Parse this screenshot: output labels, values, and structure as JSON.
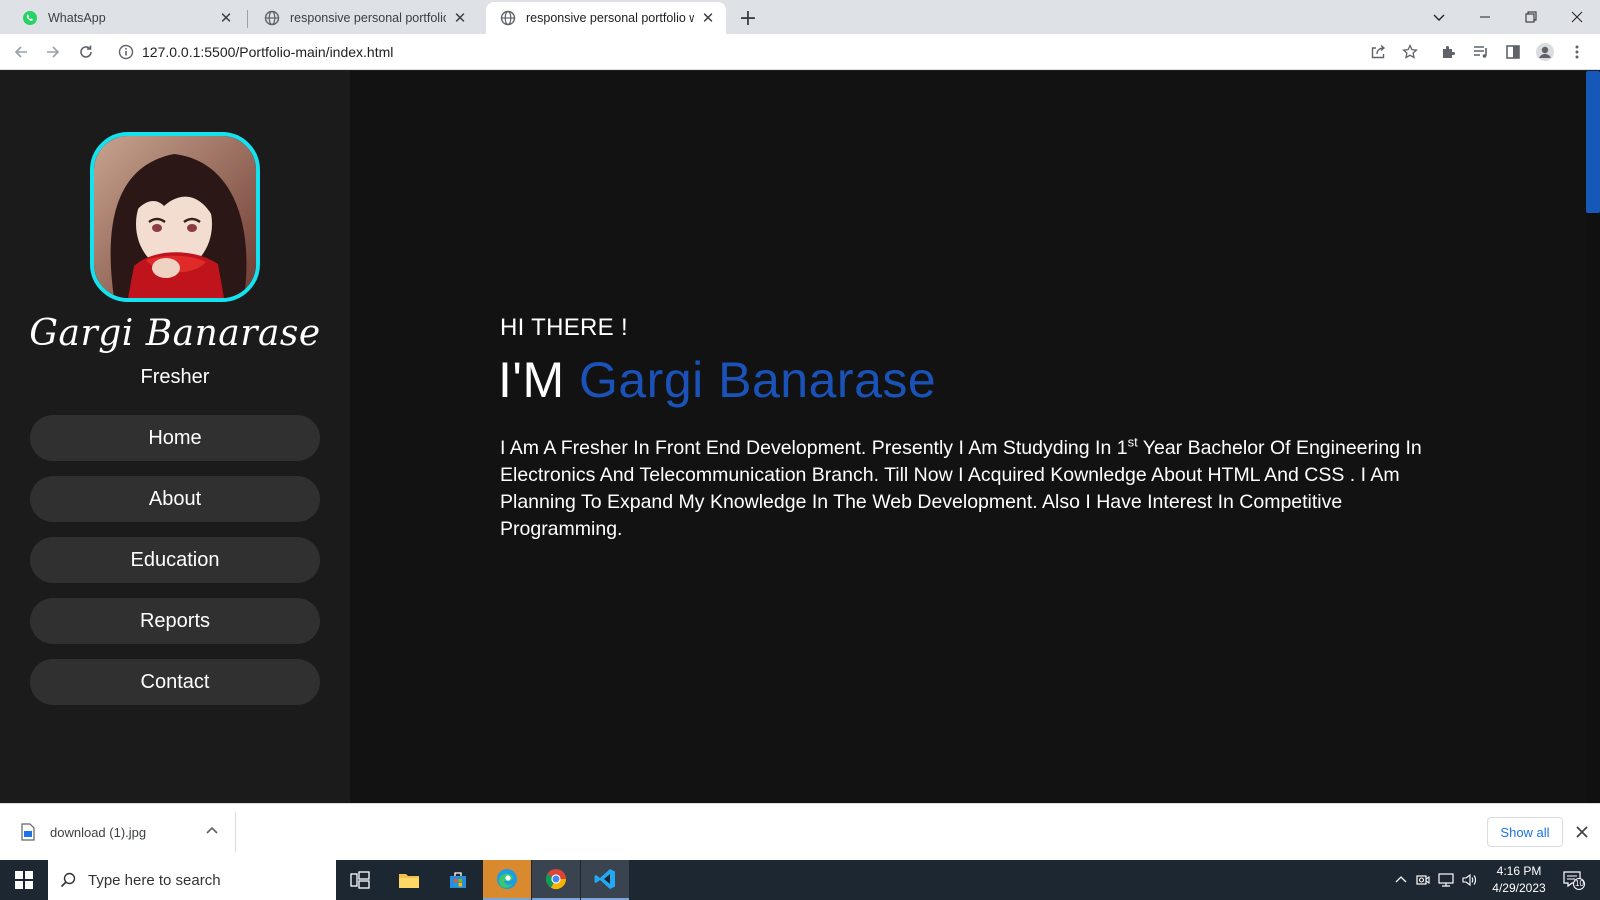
{
  "browser": {
    "tabs": [
      {
        "title": "WhatsApp",
        "active": false,
        "icon": "whatsapp-icon"
      },
      {
        "title": "responsive personal portfolio web",
        "active": false,
        "icon": "globe-icon"
      },
      {
        "title": "responsive personal portfolio web",
        "active": true,
        "icon": "globe-icon"
      }
    ],
    "url": "127.0.0.1:5500/Portfolio-main/index.html"
  },
  "page": {
    "profile": {
      "name": "Gargi Banarase",
      "role": "Fresher"
    },
    "nav": [
      "Home",
      "About",
      "Education",
      "Reports",
      "Contact"
    ],
    "hero": {
      "greeting": "HI THERE !",
      "intro_prefix": "I'M ",
      "highlight_name": "Gargi Banarase",
      "description_part1": "I Am A Fresher In Front End Development. Presently I Am Studyding In 1",
      "description_sup": "st",
      "description_part2": " Year Bachelor Of Engineering In Electronics And Telecommunication Branch. Till Now I Acquired Kownledge About HTML And CSS . I Am Planning To Expand My Knowledge In The Web Development. Also I Have Interest In Competitive Programming."
    },
    "colors": {
      "accent": "#1a52b8",
      "avatar_border": "#14e3ef",
      "sidebar_bg": "#1b1b1c",
      "content_bg": "#121212"
    }
  },
  "downloads": {
    "file_name": "download (1).jpg",
    "show_all_label": "Show all"
  },
  "taskbar": {
    "search_placeholder": "Type here to search",
    "time": "4:16 PM",
    "date": "4/29/2023",
    "notification_count": "10"
  }
}
